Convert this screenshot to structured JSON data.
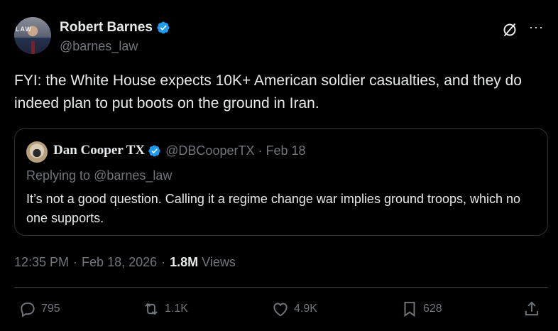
{
  "author": {
    "display_name": "Robert Barnes",
    "handle": "@barnes_law",
    "verified": true,
    "avatar_text": "LAW"
  },
  "tweet": {
    "text": "FYI: the White House expects 10K+ American soldier casualties, and they do indeed plan to put boots on the ground in Iran."
  },
  "quoted_tweet": {
    "display_name": "Dan Cooper TX",
    "handle": "@DBCooperTX",
    "separator": "·",
    "date": "Feb 18",
    "replying_prefix": "Replying to ",
    "replying_to": "@barnes_law",
    "text": "It’s not a good question. Calling it a regime change war implies ground troops, which no one supports."
  },
  "meta": {
    "time": "12:35 PM",
    "separator": "·",
    "date": "Feb 18, 2026",
    "views_count": "1.8M",
    "views_label": "Views"
  },
  "actions": {
    "replies": "795",
    "reposts": "1.1K",
    "likes": "4.9K",
    "bookmarks": "628"
  },
  "icons": {
    "verified": "verified-badge-icon",
    "grok": "grok-icon",
    "more": "more-icon",
    "reply": "reply-icon",
    "retweet": "retweet-icon",
    "like": "heart-icon",
    "bookmark": "bookmark-icon",
    "share": "share-icon"
  },
  "colors": {
    "background": "#000000",
    "text": "#e7e9ea",
    "secondary": "#71767b",
    "verified_blue": "#1d9bf0",
    "border": "#2f3336"
  }
}
